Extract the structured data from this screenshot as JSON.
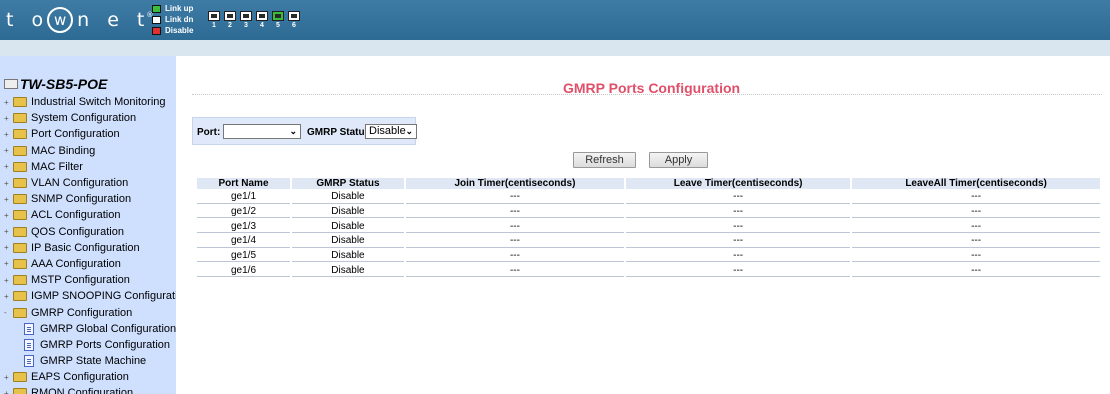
{
  "header": {
    "logo_text": "t o",
    "logo_w": "w",
    "logo_tail": "n e t",
    "logo_reg": "®",
    "legend": [
      {
        "label": "Link up",
        "color": "#3bbf3b",
        "icon": "port-up-icon"
      },
      {
        "label": "Link dn",
        "color": "#ffffff",
        "icon": "port-down-icon"
      },
      {
        "label": "Disable",
        "color": "#e03030",
        "icon": "port-disabled-icon"
      }
    ],
    "ports": [
      {
        "num": "1",
        "state": "down"
      },
      {
        "num": "2",
        "state": "down"
      },
      {
        "num": "3",
        "state": "down"
      },
      {
        "num": "4",
        "state": "down"
      },
      {
        "num": "5",
        "state": "up"
      },
      {
        "num": "6",
        "state": "down"
      }
    ]
  },
  "sidebar": {
    "root": "TW-SB5-POE",
    "items": [
      {
        "label": "Industrial Switch Monitoring",
        "expander": "+"
      },
      {
        "label": "System Configuration",
        "expander": "+"
      },
      {
        "label": "Port Configuration",
        "expander": "+"
      },
      {
        "label": "MAC Binding",
        "expander": "+"
      },
      {
        "label": "MAC Filter",
        "expander": "+"
      },
      {
        "label": "VLAN Configuration",
        "expander": "+"
      },
      {
        "label": "SNMP Configuration",
        "expander": "+"
      },
      {
        "label": "ACL Configuration",
        "expander": "+"
      },
      {
        "label": "QOS Configuration",
        "expander": "+"
      },
      {
        "label": "IP Basic Configuration",
        "expander": "+"
      },
      {
        "label": "AAA Configuration",
        "expander": "+"
      },
      {
        "label": "MSTP Configuration",
        "expander": "+"
      },
      {
        "label": "IGMP SNOOPING Configuration",
        "expander": "+"
      },
      {
        "label": "GMRP Configuration",
        "expander": "-"
      },
      {
        "label": "GMRP Global Configuration",
        "child": true
      },
      {
        "label": "GMRP Ports Configuration",
        "child": true
      },
      {
        "label": "GMRP State Machine",
        "child": true
      },
      {
        "label": "EAPS Configuration",
        "expander": "+"
      },
      {
        "label": "RMON Configuration",
        "expander": "+"
      }
    ]
  },
  "main": {
    "title": "GMRP Ports Configuration",
    "filter": {
      "port_label": "Port:",
      "port_value": "",
      "status_label": "GMRP Status:",
      "status_value": "Disable"
    },
    "buttons": {
      "refresh": "Refresh",
      "apply": "Apply"
    },
    "table": {
      "headers": [
        "Port Name",
        "GMRP Status",
        "Join Timer(centiseconds)",
        "Leave Timer(centiseconds)",
        "LeaveAll Timer(centiseconds)"
      ],
      "rows": [
        [
          "ge1/1",
          "Disable",
          "---",
          "---",
          "---"
        ],
        [
          "ge1/2",
          "Disable",
          "---",
          "---",
          "---"
        ],
        [
          "ge1/3",
          "Disable",
          "---",
          "---",
          "---"
        ],
        [
          "ge1/4",
          "Disable",
          "---",
          "---",
          "---"
        ],
        [
          "ge1/5",
          "Disable",
          "---",
          "---",
          "---"
        ],
        [
          "ge1/6",
          "Disable",
          "---",
          "---",
          "---"
        ]
      ]
    }
  },
  "colors": {
    "header_bg": "#2d6a94",
    "sidebar_bg": "#cfe0ff",
    "title": "#e0506a",
    "port_up": "#3bbf3b"
  }
}
